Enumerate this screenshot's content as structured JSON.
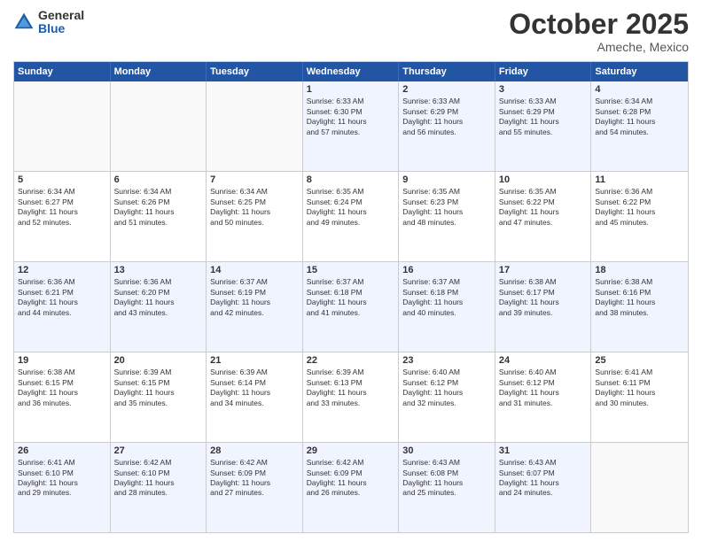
{
  "logo": {
    "general": "General",
    "blue": "Blue"
  },
  "header": {
    "month": "October 2025",
    "location": "Ameche, Mexico"
  },
  "weekdays": [
    "Sunday",
    "Monday",
    "Tuesday",
    "Wednesday",
    "Thursday",
    "Friday",
    "Saturday"
  ],
  "rows": [
    [
      {
        "day": "",
        "text": ""
      },
      {
        "day": "",
        "text": ""
      },
      {
        "day": "",
        "text": ""
      },
      {
        "day": "1",
        "text": "Sunrise: 6:33 AM\nSunset: 6:30 PM\nDaylight: 11 hours\nand 57 minutes."
      },
      {
        "day": "2",
        "text": "Sunrise: 6:33 AM\nSunset: 6:29 PM\nDaylight: 11 hours\nand 56 minutes."
      },
      {
        "day": "3",
        "text": "Sunrise: 6:33 AM\nSunset: 6:29 PM\nDaylight: 11 hours\nand 55 minutes."
      },
      {
        "day": "4",
        "text": "Sunrise: 6:34 AM\nSunset: 6:28 PM\nDaylight: 11 hours\nand 54 minutes."
      }
    ],
    [
      {
        "day": "5",
        "text": "Sunrise: 6:34 AM\nSunset: 6:27 PM\nDaylight: 11 hours\nand 52 minutes."
      },
      {
        "day": "6",
        "text": "Sunrise: 6:34 AM\nSunset: 6:26 PM\nDaylight: 11 hours\nand 51 minutes."
      },
      {
        "day": "7",
        "text": "Sunrise: 6:34 AM\nSunset: 6:25 PM\nDaylight: 11 hours\nand 50 minutes."
      },
      {
        "day": "8",
        "text": "Sunrise: 6:35 AM\nSunset: 6:24 PM\nDaylight: 11 hours\nand 49 minutes."
      },
      {
        "day": "9",
        "text": "Sunrise: 6:35 AM\nSunset: 6:23 PM\nDaylight: 11 hours\nand 48 minutes."
      },
      {
        "day": "10",
        "text": "Sunrise: 6:35 AM\nSunset: 6:22 PM\nDaylight: 11 hours\nand 47 minutes."
      },
      {
        "day": "11",
        "text": "Sunrise: 6:36 AM\nSunset: 6:22 PM\nDaylight: 11 hours\nand 45 minutes."
      }
    ],
    [
      {
        "day": "12",
        "text": "Sunrise: 6:36 AM\nSunset: 6:21 PM\nDaylight: 11 hours\nand 44 minutes."
      },
      {
        "day": "13",
        "text": "Sunrise: 6:36 AM\nSunset: 6:20 PM\nDaylight: 11 hours\nand 43 minutes."
      },
      {
        "day": "14",
        "text": "Sunrise: 6:37 AM\nSunset: 6:19 PM\nDaylight: 11 hours\nand 42 minutes."
      },
      {
        "day": "15",
        "text": "Sunrise: 6:37 AM\nSunset: 6:18 PM\nDaylight: 11 hours\nand 41 minutes."
      },
      {
        "day": "16",
        "text": "Sunrise: 6:37 AM\nSunset: 6:18 PM\nDaylight: 11 hours\nand 40 minutes."
      },
      {
        "day": "17",
        "text": "Sunrise: 6:38 AM\nSunset: 6:17 PM\nDaylight: 11 hours\nand 39 minutes."
      },
      {
        "day": "18",
        "text": "Sunrise: 6:38 AM\nSunset: 6:16 PM\nDaylight: 11 hours\nand 38 minutes."
      }
    ],
    [
      {
        "day": "19",
        "text": "Sunrise: 6:38 AM\nSunset: 6:15 PM\nDaylight: 11 hours\nand 36 minutes."
      },
      {
        "day": "20",
        "text": "Sunrise: 6:39 AM\nSunset: 6:15 PM\nDaylight: 11 hours\nand 35 minutes."
      },
      {
        "day": "21",
        "text": "Sunrise: 6:39 AM\nSunset: 6:14 PM\nDaylight: 11 hours\nand 34 minutes."
      },
      {
        "day": "22",
        "text": "Sunrise: 6:39 AM\nSunset: 6:13 PM\nDaylight: 11 hours\nand 33 minutes."
      },
      {
        "day": "23",
        "text": "Sunrise: 6:40 AM\nSunset: 6:12 PM\nDaylight: 11 hours\nand 32 minutes."
      },
      {
        "day": "24",
        "text": "Sunrise: 6:40 AM\nSunset: 6:12 PM\nDaylight: 11 hours\nand 31 minutes."
      },
      {
        "day": "25",
        "text": "Sunrise: 6:41 AM\nSunset: 6:11 PM\nDaylight: 11 hours\nand 30 minutes."
      }
    ],
    [
      {
        "day": "26",
        "text": "Sunrise: 6:41 AM\nSunset: 6:10 PM\nDaylight: 11 hours\nand 29 minutes."
      },
      {
        "day": "27",
        "text": "Sunrise: 6:42 AM\nSunset: 6:10 PM\nDaylight: 11 hours\nand 28 minutes."
      },
      {
        "day": "28",
        "text": "Sunrise: 6:42 AM\nSunset: 6:09 PM\nDaylight: 11 hours\nand 27 minutes."
      },
      {
        "day": "29",
        "text": "Sunrise: 6:42 AM\nSunset: 6:09 PM\nDaylight: 11 hours\nand 26 minutes."
      },
      {
        "day": "30",
        "text": "Sunrise: 6:43 AM\nSunset: 6:08 PM\nDaylight: 11 hours\nand 25 minutes."
      },
      {
        "day": "31",
        "text": "Sunrise: 6:43 AM\nSunset: 6:07 PM\nDaylight: 11 hours\nand 24 minutes."
      },
      {
        "day": "",
        "text": ""
      }
    ]
  ]
}
